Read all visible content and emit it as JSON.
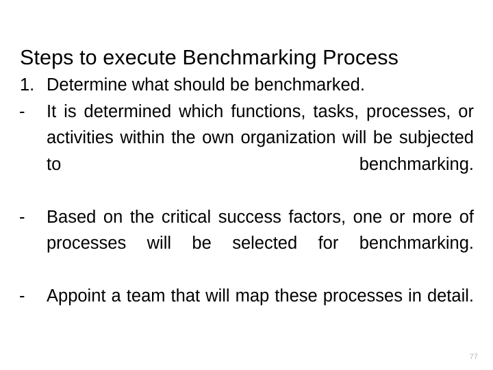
{
  "slide": {
    "title": "Steps to execute Benchmarking Process",
    "page_number": "77",
    "background_color": "#ffffff",
    "text_color": "#000000",
    "page_number_color": "#b4b4b4",
    "items": [
      {
        "marker": "1.",
        "marker_type": "number",
        "text": "Determine what should be benchmarked.",
        "justified": false
      },
      {
        "marker": "-",
        "marker_type": "dash",
        "text": "It is determined which functions, tasks, processes, or activities within the own organization will be subjected to benchmarking.",
        "justified": true
      },
      {
        "marker": "-",
        "marker_type": "dash",
        "text": "Based on the critical success factors, one or more of processes will be selected for benchmarking.",
        "justified": true
      },
      {
        "marker": "-",
        "marker_type": "dash",
        "text": "Appoint a team that will map these processes in detail.",
        "justified": true
      }
    ]
  }
}
